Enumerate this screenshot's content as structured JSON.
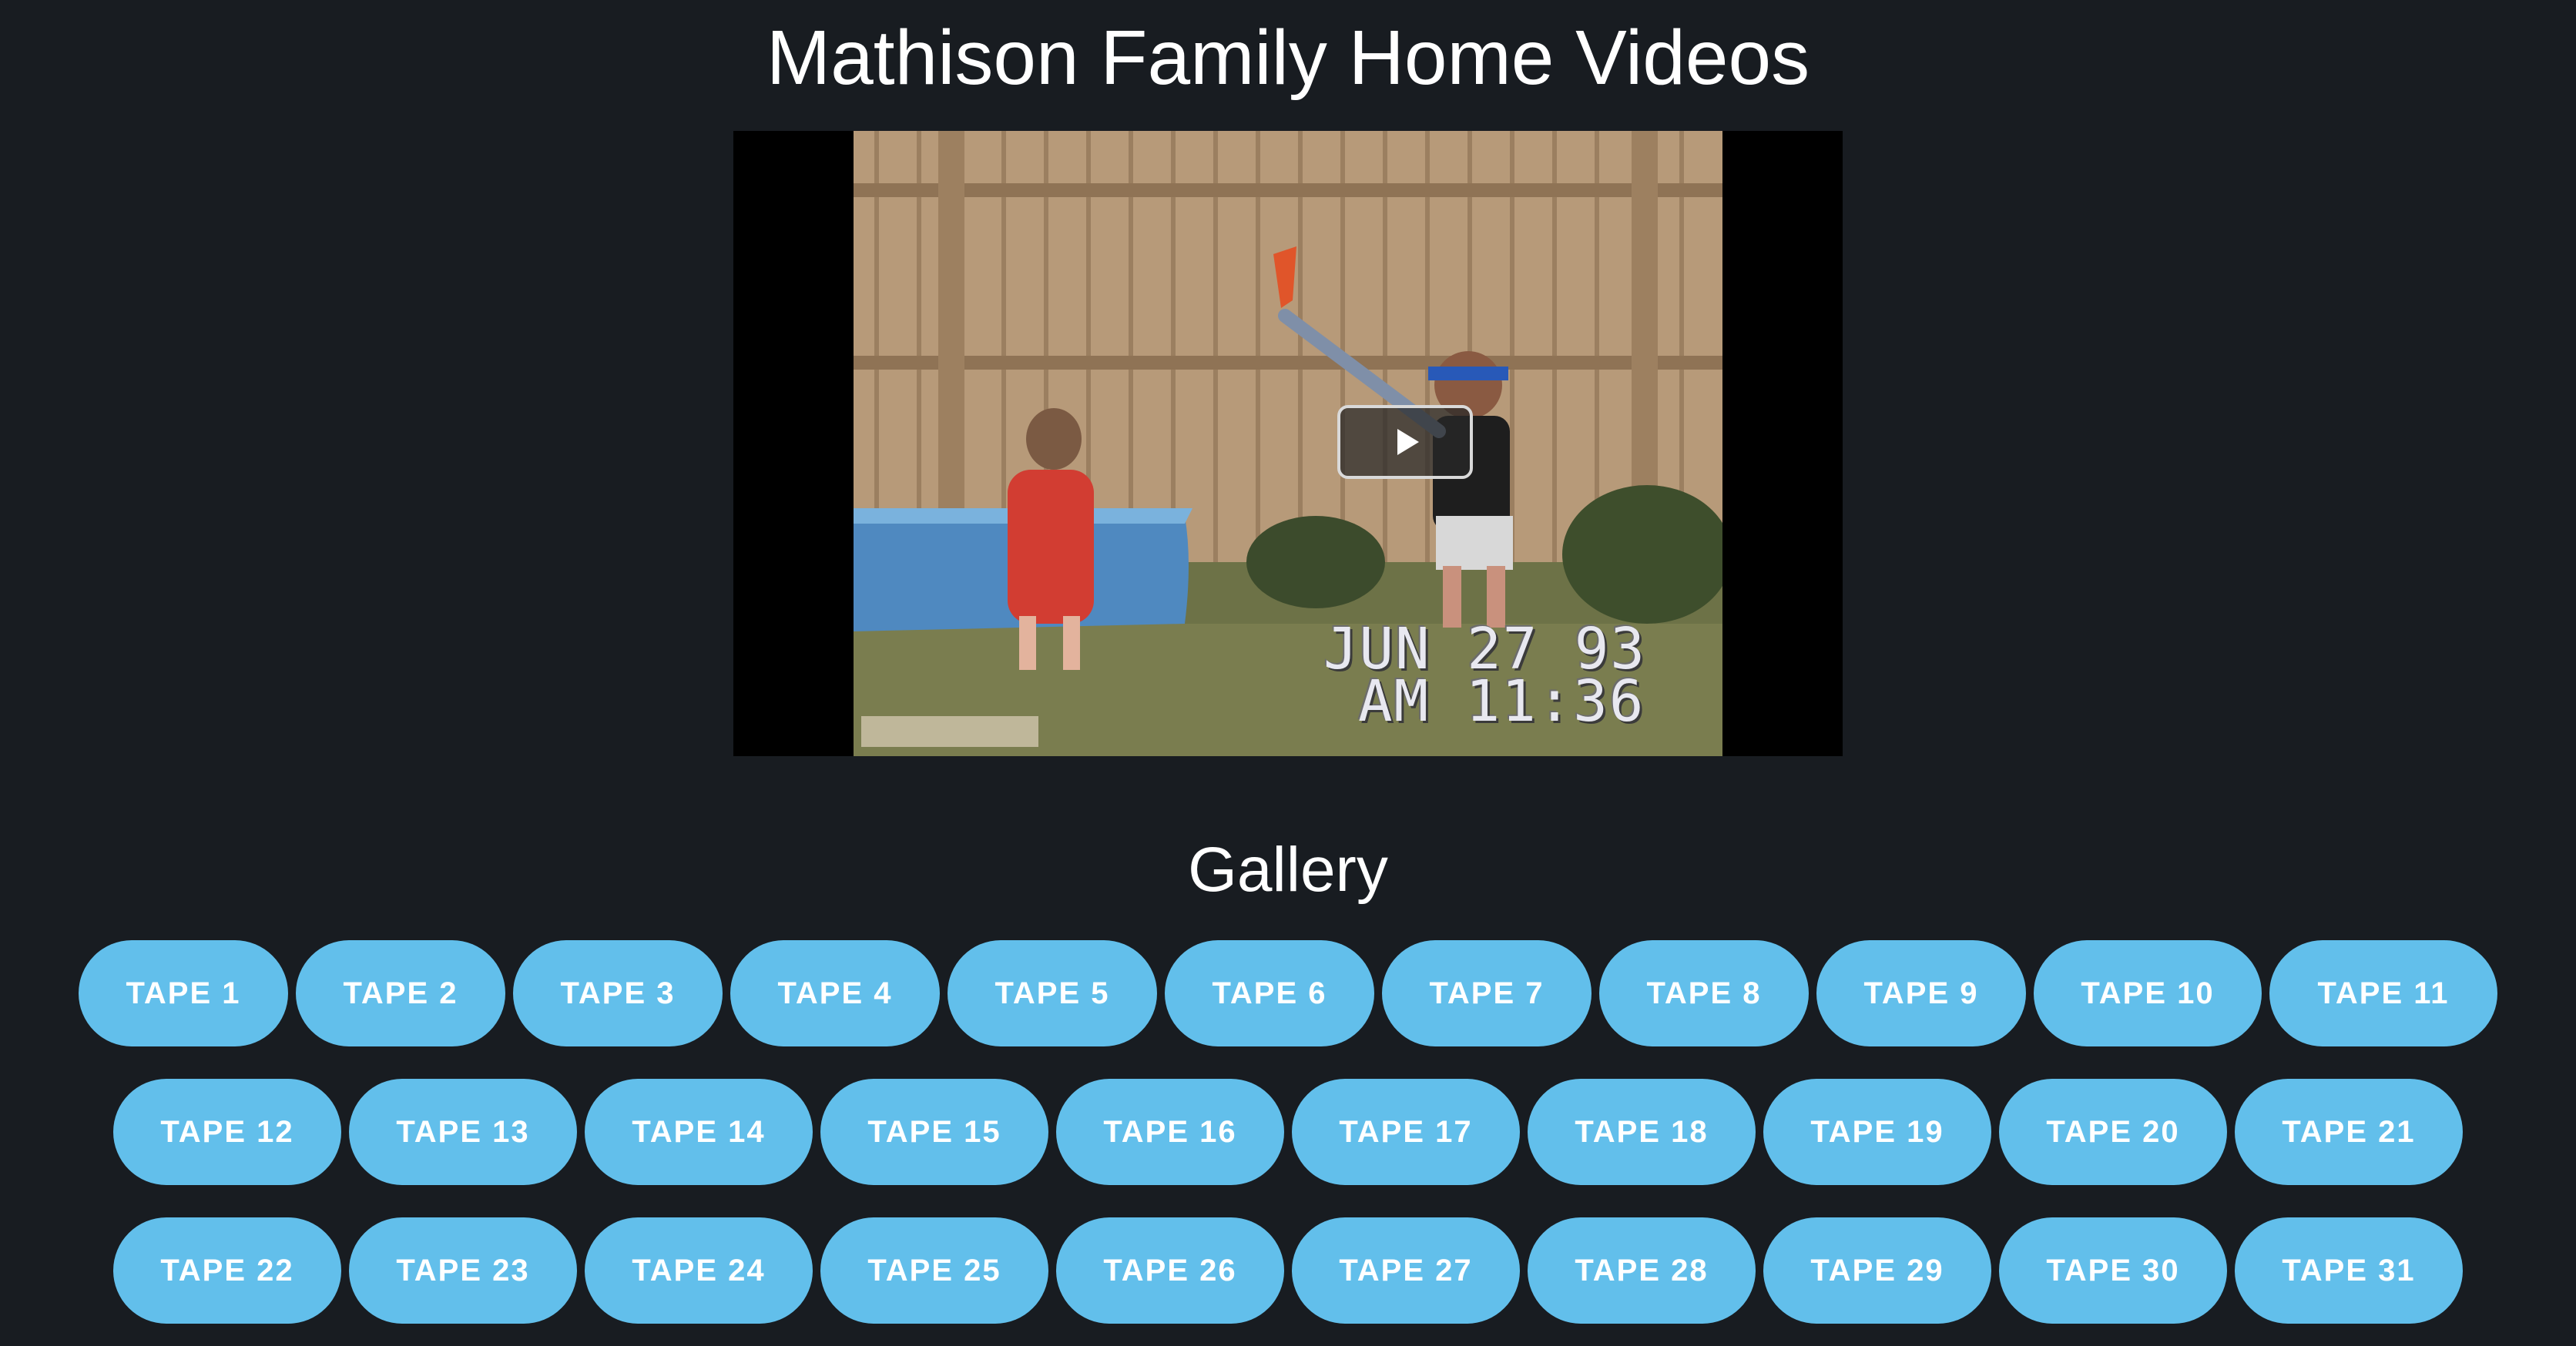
{
  "header": {
    "title": "Mathison Family Home Videos"
  },
  "player": {
    "play_icon": "play-icon",
    "overlay_date": "JUN 27 93",
    "overlay_time": "AM 11:36"
  },
  "gallery": {
    "title": "Gallery",
    "tapes": [
      "TAPE 1",
      "TAPE 2",
      "TAPE 3",
      "TAPE 4",
      "TAPE 5",
      "TAPE 6",
      "TAPE 7",
      "TAPE 8",
      "TAPE 9",
      "TAPE 10",
      "TAPE 11",
      "TAPE 12",
      "TAPE 13",
      "TAPE 14",
      "TAPE 15",
      "TAPE 16",
      "TAPE 17",
      "TAPE 18",
      "TAPE 19",
      "TAPE 20",
      "TAPE 21",
      "TAPE 22",
      "TAPE 23",
      "TAPE 24",
      "TAPE 25",
      "TAPE 26",
      "TAPE 27",
      "TAPE 28",
      "TAPE 29",
      "TAPE 30",
      "TAPE 31"
    ]
  },
  "colors": {
    "background": "#181c21",
    "button": "#62bfeb",
    "text": "#ffffff"
  }
}
